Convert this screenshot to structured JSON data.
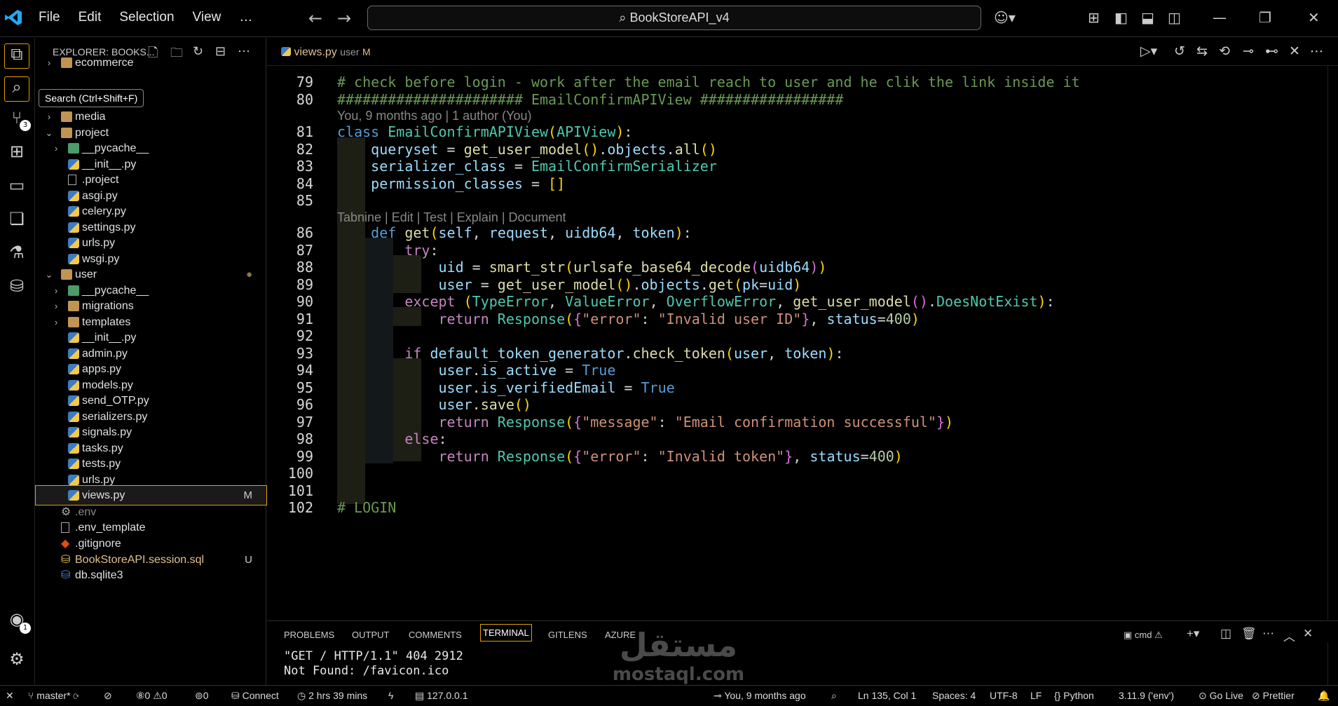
{
  "titlebar": {
    "menu": [
      "File",
      "Edit",
      "Selection",
      "View",
      "…"
    ],
    "search": "BookStoreAPI_v4"
  },
  "tooltip": "Search (Ctrl+Shift+F)",
  "activity_badges": {
    "scm": "3",
    "account": "1"
  },
  "sidebar": {
    "title": "EXPLORER: BOOKS...",
    "items": [
      {
        "label": "ecommerce",
        "status": ""
      },
      {
        "label": "media",
        "status": ""
      },
      {
        "label": "project",
        "status": ""
      },
      {
        "label": "__pycache__",
        "status": ""
      },
      {
        "label": "__init__.py",
        "status": ""
      },
      {
        "label": ".project",
        "status": ""
      },
      {
        "label": "asgi.py",
        "status": ""
      },
      {
        "label": "celery.py",
        "status": ""
      },
      {
        "label": "settings.py",
        "status": ""
      },
      {
        "label": "urls.py",
        "status": ""
      },
      {
        "label": "wsgi.py",
        "status": ""
      },
      {
        "label": "user",
        "status": "●"
      },
      {
        "label": "__pycache__",
        "status": ""
      },
      {
        "label": "migrations",
        "status": ""
      },
      {
        "label": "templates",
        "status": ""
      },
      {
        "label": "__init__.py",
        "status": ""
      },
      {
        "label": "admin.py",
        "status": ""
      },
      {
        "label": "apps.py",
        "status": ""
      },
      {
        "label": "models.py",
        "status": ""
      },
      {
        "label": "send_OTP.py",
        "status": ""
      },
      {
        "label": "serializers.py",
        "status": ""
      },
      {
        "label": "signals.py",
        "status": ""
      },
      {
        "label": "tasks.py",
        "status": ""
      },
      {
        "label": "tests.py",
        "status": ""
      },
      {
        "label": "urls.py",
        "status": ""
      },
      {
        "label": "views.py",
        "status": "M"
      },
      {
        "label": ".env",
        "status": ""
      },
      {
        "label": ".env_template",
        "status": ""
      },
      {
        "label": ".gitignore",
        "status": ""
      },
      {
        "label": "BookStoreAPI.session.sql",
        "status": "U"
      },
      {
        "label": "db.sqlite3",
        "status": ""
      }
    ]
  },
  "tab": {
    "file": "views.py",
    "context": "user",
    "status": "M"
  },
  "code": {
    "blame": "You, 9 months ago | 1 author (You)",
    "codelens": "Tabnine | Edit | Test | Explain | Document",
    "line_numbers": [
      "79",
      "80",
      "81",
      "82",
      "83",
      "84",
      "85",
      "86",
      "87",
      "88",
      "89",
      "90",
      "91",
      "92",
      "93",
      "94",
      "95",
      "96",
      "97",
      "98",
      "99",
      "100",
      "101",
      "102"
    ]
  },
  "panel": {
    "tabs": [
      "PROBLEMS",
      "OUTPUT",
      "COMMENTS",
      "TERMINAL",
      "GITLENS",
      "AZURE"
    ],
    "shell": "cmd",
    "terminal_lines": [
      "\"GET / HTTP/1.1\" 404 2912",
      "Not Found: /favicon.ico"
    ]
  },
  "watermark": {
    "arabic": "مستقل",
    "latin": "mostaql.com"
  },
  "statusbar": {
    "branch": "master*",
    "problems": "⑧0 ⚠0",
    "ports": "0",
    "connect": "Connect",
    "time": "2 hrs 39 mins",
    "host": "127.0.0.1",
    "blame": "You, 9 months ago",
    "position": "Ln 135, Col 1",
    "spaces": "Spaces: 4",
    "encoding": "UTF-8",
    "eol": "LF",
    "language": "Python",
    "interpreter": "3.11.9 ('env')",
    "golive": "Go Live",
    "prettier": "Prettier"
  }
}
